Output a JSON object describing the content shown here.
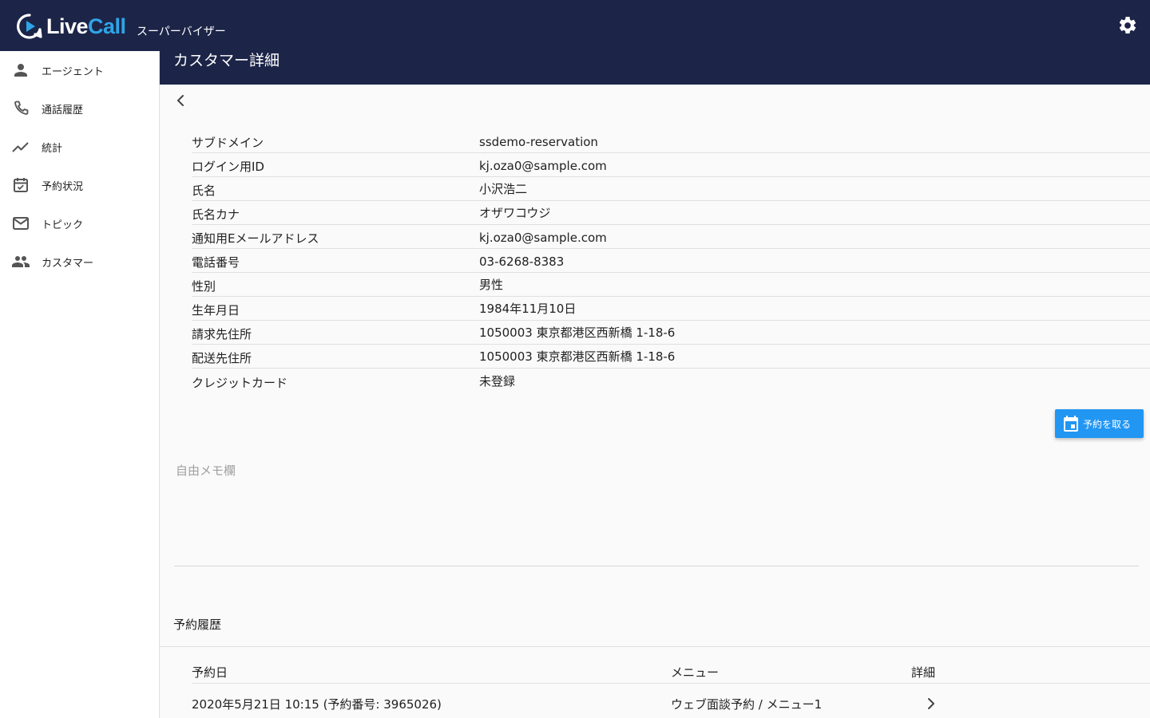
{
  "app": {
    "brand_live": "Live",
    "brand_call": "Call",
    "role": "スーパーバイザー",
    "page_title": "カスタマー詳細"
  },
  "sidebar": {
    "items": [
      {
        "label": "エージェント",
        "icon": "person-icon"
      },
      {
        "label": "通話履歴",
        "icon": "phone-icon"
      },
      {
        "label": "統計",
        "icon": "trending-up-icon"
      },
      {
        "label": "予約状況",
        "icon": "event-available-icon"
      },
      {
        "label": "トピック",
        "icon": "mail-icon"
      },
      {
        "label": "カスタマー",
        "icon": "people-icon"
      }
    ]
  },
  "customer": {
    "fields": [
      {
        "label": "サブドメイン",
        "value": "ssdemo-reservation"
      },
      {
        "label": "ログイン用ID",
        "value": "kj.oza0@sample.com"
      },
      {
        "label": "氏名",
        "value": "小沢浩二"
      },
      {
        "label": "氏名カナ",
        "value": "オザワコウジ"
      },
      {
        "label": "通知用Eメールアドレス",
        "value": "kj.oza0@sample.com"
      },
      {
        "label": "電話番号",
        "value": "03-6268-8383"
      },
      {
        "label": "性別",
        "value": "男性"
      },
      {
        "label": "生年月日",
        "value": "1984年11月10日"
      },
      {
        "label": "請求先住所",
        "value": "1050003 東京都港区西新橋 1-18-6"
      },
      {
        "label": "配送先住所",
        "value": "1050003 東京都港区西新橋 1-18-6"
      },
      {
        "label": "クレジットカード",
        "value": "未登録"
      }
    ]
  },
  "actions": {
    "reserve_label": "予約を取る"
  },
  "memo": {
    "placeholder": "自由メモ欄",
    "value": ""
  },
  "history": {
    "title": "予約履歴",
    "columns": [
      "予約日",
      "メニュー",
      "詳細"
    ],
    "rows": [
      {
        "date": "2020年5月21日 10:15 (予約番号: 3965026)",
        "menu": "ウェブ面談予約 / メニュー1"
      }
    ]
  },
  "colors": {
    "header_bg": "#1c2548",
    "accent": "#2196f3",
    "brand_call": "#2fa4e7"
  }
}
